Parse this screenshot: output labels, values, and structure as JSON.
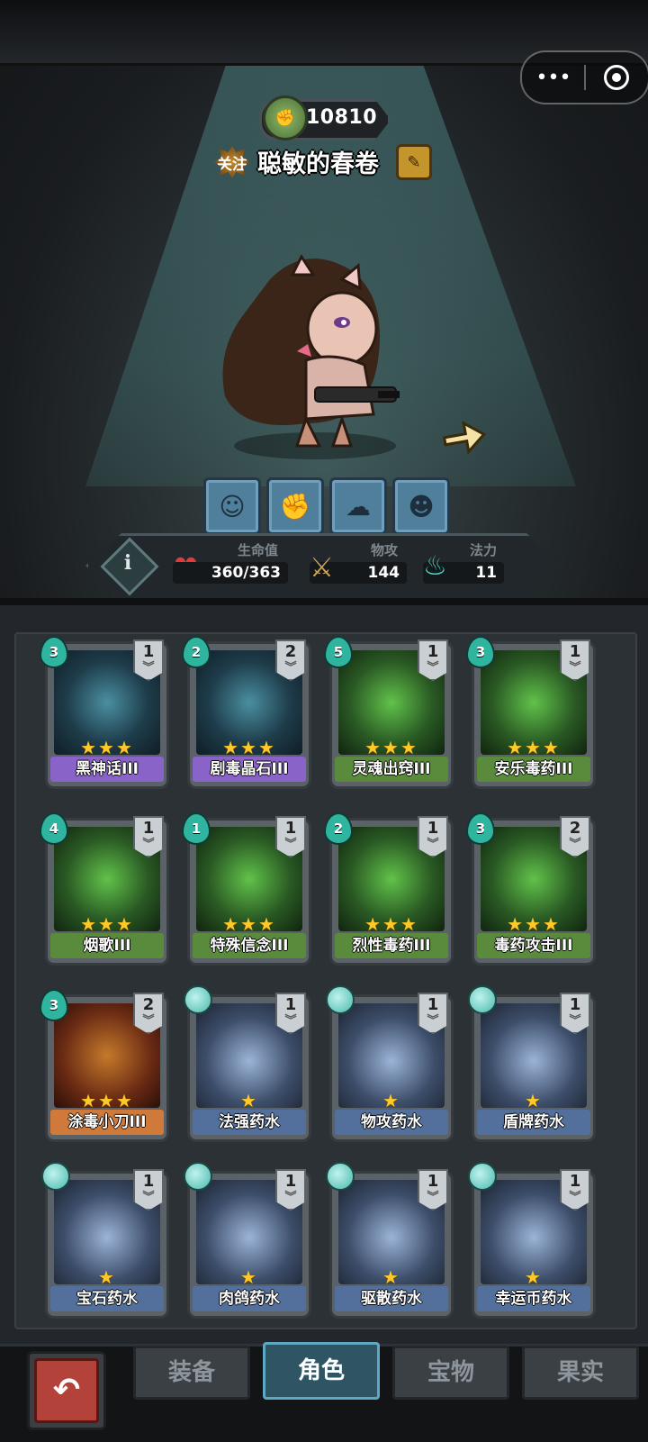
{
  "header": {
    "currency_value": "10810",
    "follow_label": "关注",
    "player_name": "聪敏的春卷"
  },
  "stats": {
    "hp_label": "生命值",
    "hp_value": "360/363",
    "atk_label": "物攻",
    "atk_value": "144",
    "mana_label": "法力",
    "mana_value": "11",
    "info_glyph": "i"
  },
  "cards": [
    {
      "name": "黑神话III",
      "level": "3",
      "count": "1",
      "stars": "★★★",
      "color": "purple",
      "kind": "skill"
    },
    {
      "name": "剧毒晶石III",
      "level": "2",
      "count": "2",
      "stars": "★★★",
      "color": "purple",
      "kind": "skill"
    },
    {
      "name": "灵魂出窍III",
      "level": "5",
      "count": "1",
      "stars": "★★★",
      "color": "green",
      "kind": "skill"
    },
    {
      "name": "安乐毒药III",
      "level": "3",
      "count": "1",
      "stars": "★★★",
      "color": "green",
      "kind": "skill"
    },
    {
      "name": "烟歌III",
      "level": "4",
      "count": "1",
      "stars": "★★★",
      "color": "green",
      "kind": "skill"
    },
    {
      "name": "特殊信念III",
      "level": "1",
      "count": "1",
      "stars": "★★★",
      "color": "green",
      "kind": "skill"
    },
    {
      "name": "烈性毒药III",
      "level": "2",
      "count": "1",
      "stars": "★★★",
      "color": "green",
      "kind": "skill"
    },
    {
      "name": "毒药攻击III",
      "level": "3",
      "count": "2",
      "stars": "★★★",
      "color": "green",
      "kind": "skill"
    },
    {
      "name": "涂毒小刀III",
      "level": "3",
      "count": "2",
      "stars": "★★★",
      "color": "orange",
      "kind": "skill"
    },
    {
      "name": "法强药水",
      "level": "",
      "count": "1",
      "stars": "★",
      "color": "blue",
      "kind": "potion"
    },
    {
      "name": "物攻药水",
      "level": "",
      "count": "1",
      "stars": "★",
      "color": "blue",
      "kind": "potion"
    },
    {
      "name": "盾牌药水",
      "level": "",
      "count": "1",
      "stars": "★",
      "color": "blue",
      "kind": "potion"
    },
    {
      "name": "宝石药水",
      "level": "",
      "count": "1",
      "stars": "★",
      "color": "blue",
      "kind": "potion"
    },
    {
      "name": "肉鸽药水",
      "level": "",
      "count": "1",
      "stars": "★",
      "color": "blue",
      "kind": "potion"
    },
    {
      "name": "驱散药水",
      "level": "",
      "count": "1",
      "stars": "★",
      "color": "blue",
      "kind": "potion"
    },
    {
      "name": "幸运币药水",
      "level": "",
      "count": "1",
      "stars": "★",
      "color": "blue",
      "kind": "potion"
    }
  ],
  "tabs": [
    {
      "label": "装备",
      "active": false
    },
    {
      "label": "角色",
      "active": true
    },
    {
      "label": "宝物",
      "active": false
    },
    {
      "label": "果实",
      "active": false
    }
  ],
  "back_glyph": "↶"
}
